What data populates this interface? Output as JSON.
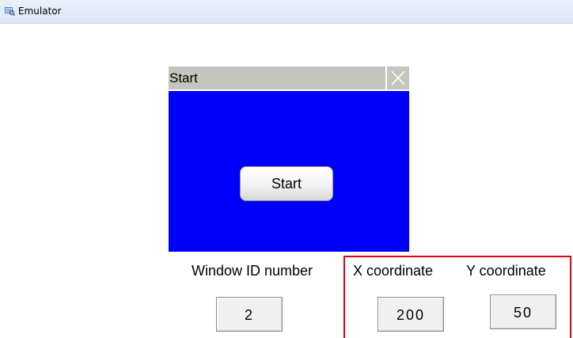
{
  "window": {
    "title": "Emulator",
    "icon": "emulator-app-icon"
  },
  "popup": {
    "title": "Start",
    "close_icon": "close-icon",
    "body_color": "#0000fa",
    "button_label": "Start"
  },
  "fields": {
    "window_id": {
      "label": "Window ID number",
      "value": "2"
    },
    "x_coordinate": {
      "label": "X coordinate",
      "value": "200"
    },
    "y_coordinate": {
      "label": "Y coordinate",
      "value": "50"
    }
  },
  "colors": {
    "highlight": "#e0000f",
    "popup_titlebar": "#c2c6bd"
  }
}
